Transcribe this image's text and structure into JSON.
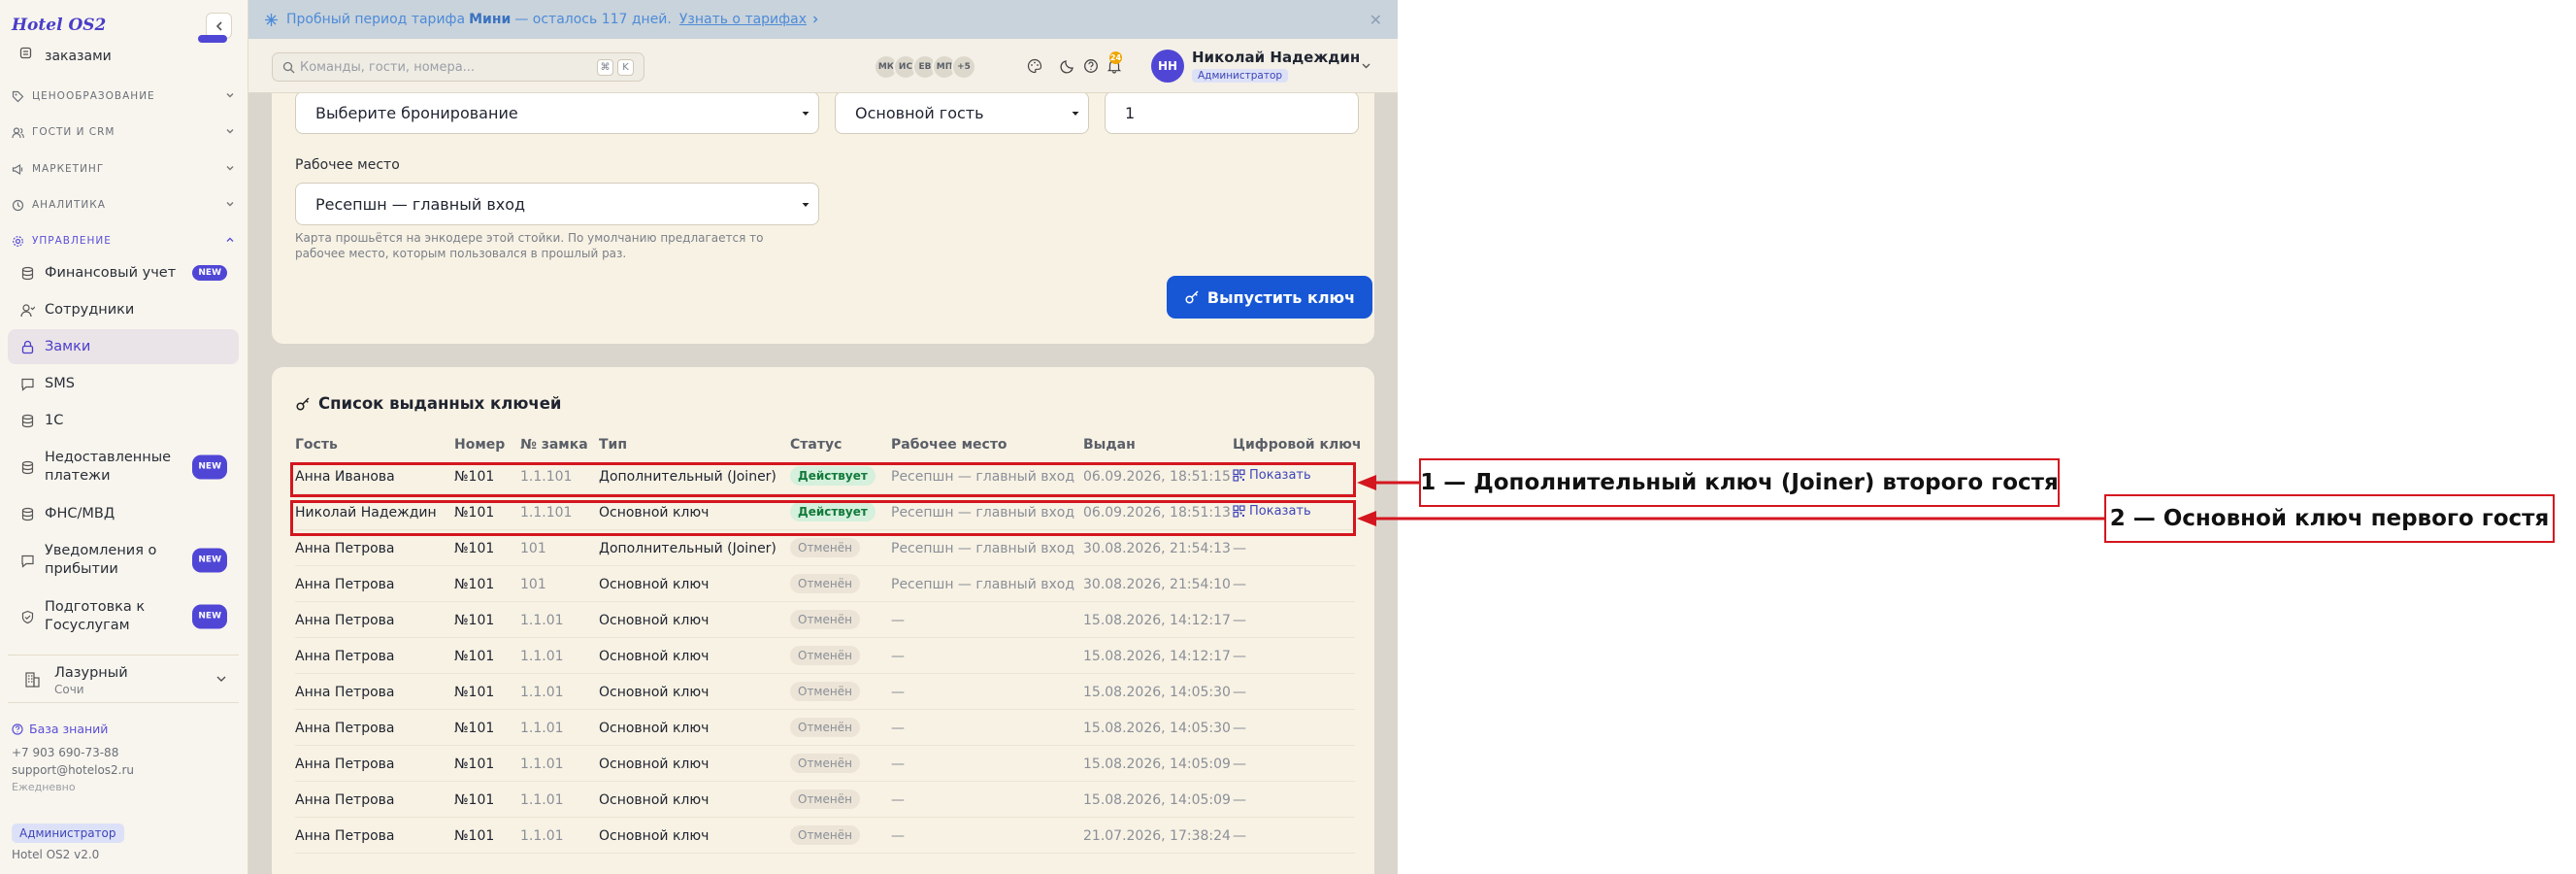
{
  "app": {
    "logo": "Hotel OS2",
    "version": "Hotel OS2 v2.0"
  },
  "banner": {
    "prefix": "Пробный период тарифа",
    "plan": "Мини",
    "suffix": "— осталось 117 дней.",
    "link": "Узнать о тарифах"
  },
  "search": {
    "placeholder": "Команды, гости, номера...",
    "kbd1": "⌘",
    "kbd2": "K"
  },
  "header": {
    "avatars": [
      "МК",
      "ИС",
      "ЕВ",
      "МП",
      "+5"
    ],
    "notif_count": "24",
    "user": {
      "initials": "НН",
      "name": "Николай Надеждин",
      "role": "Администратор"
    }
  },
  "sidebar": {
    "top_item": "заказами",
    "sections": [
      {
        "label": "ЦЕНООБРАЗОВАНИЕ"
      },
      {
        "label": "ГОСТИ И CRM"
      },
      {
        "label": "МАРКЕТИНГ"
      },
      {
        "label": "АНАЛИТИКА"
      },
      {
        "label": "УПРАВЛЕНИЕ"
      }
    ],
    "items": [
      {
        "label": "Финансовый учет",
        "badge": "NEW"
      },
      {
        "label": "Сотрудники"
      },
      {
        "label": "Замки"
      },
      {
        "label": "SMS"
      },
      {
        "label": "1С"
      },
      {
        "label": "Недоставленные платежи",
        "badge": "NEW"
      },
      {
        "label": "ФНС/МВД"
      },
      {
        "label": "Уведомления о прибытии",
        "badge": "NEW"
      },
      {
        "label": "Подготовка к Госуслугам",
        "badge": "NEW"
      }
    ],
    "hotel": {
      "name": "Лазурный",
      "city": "Сочи"
    },
    "knowledge": "База знаний",
    "phone": "+7 903 690-73-88",
    "email": "support@hotelos2.ru",
    "hours": "Ежедневно",
    "role": "Администратор"
  },
  "form": {
    "booking": "Выберите бронирование",
    "guest": "Основной гость",
    "count": "1",
    "workplace_label": "Рабочее место",
    "workplace": "Ресепшн — главный вход",
    "hint": "Карта прошьётся на энкодере этой стойки. По умолчанию предлагается то рабочее место, которым пользовался в прошлый раз.",
    "issue_button": "Выпустить ключ"
  },
  "keys": {
    "title": "Список выданных ключей",
    "columns": [
      "Гость",
      "Номер",
      "№ замка",
      "Тип",
      "Статус",
      "Рабочее место",
      "Выдан",
      "Цифровой ключ"
    ],
    "show_label": "Показать",
    "rows": [
      {
        "guest": "Анна Иванова",
        "room": "№101",
        "lock": "1.1.101",
        "type": "Дополнительный (Joiner)",
        "status": "Действует",
        "active": true,
        "place": "Ресепшн — главный вход",
        "issued": "06.09.2026, 18:51:15",
        "digital": "show"
      },
      {
        "guest": "Николай Надеждин",
        "room": "№101",
        "lock": "1.1.101",
        "type": "Основной ключ",
        "status": "Действует",
        "active": true,
        "place": "Ресепшн — главный вход",
        "issued": "06.09.2026, 18:51:13",
        "digital": "show"
      },
      {
        "guest": "Анна Петрова",
        "room": "№101",
        "lock": "101",
        "type": "Дополнительный (Joiner)",
        "status": "Отменён",
        "active": false,
        "place": "Ресепшн — главный вход",
        "issued": "30.08.2026, 21:54:13",
        "digital": "—"
      },
      {
        "guest": "Анна Петрова",
        "room": "№101",
        "lock": "101",
        "type": "Основной ключ",
        "status": "Отменён",
        "active": false,
        "place": "Ресепшн — главный вход",
        "issued": "30.08.2026, 21:54:10",
        "digital": "—"
      },
      {
        "guest": "Анна Петрова",
        "room": "№101",
        "lock": "1.1.01",
        "type": "Основной ключ",
        "status": "Отменён",
        "active": false,
        "place": "—",
        "issued": "15.08.2026, 14:12:17",
        "digital": "—"
      },
      {
        "guest": "Анна Петрова",
        "room": "№101",
        "lock": "1.1.01",
        "type": "Основной ключ",
        "status": "Отменён",
        "active": false,
        "place": "—",
        "issued": "15.08.2026, 14:12:17",
        "digital": "—"
      },
      {
        "guest": "Анна Петрова",
        "room": "№101",
        "lock": "1.1.01",
        "type": "Основной ключ",
        "status": "Отменён",
        "active": false,
        "place": "—",
        "issued": "15.08.2026, 14:05:30",
        "digital": "—"
      },
      {
        "guest": "Анна Петрова",
        "room": "№101",
        "lock": "1.1.01",
        "type": "Основной ключ",
        "status": "Отменён",
        "active": false,
        "place": "—",
        "issued": "15.08.2026, 14:05:30",
        "digital": "—"
      },
      {
        "guest": "Анна Петрова",
        "room": "№101",
        "lock": "1.1.01",
        "type": "Основной ключ",
        "status": "Отменён",
        "active": false,
        "place": "—",
        "issued": "15.08.2026, 14:05:09",
        "digital": "—"
      },
      {
        "guest": "Анна Петрова",
        "room": "№101",
        "lock": "1.1.01",
        "type": "Основной ключ",
        "status": "Отменён",
        "active": false,
        "place": "—",
        "issued": "15.08.2026, 14:05:09",
        "digital": "—"
      },
      {
        "guest": "Анна Петрова",
        "room": "№101",
        "lock": "1.1.01",
        "type": "Основной ключ",
        "status": "Отменён",
        "active": false,
        "place": "—",
        "issued": "21.07.2026, 17:38:24",
        "digital": "—"
      }
    ]
  },
  "annotations": {
    "callout1": "1 — Дополнительный ключ (Joiner) второго гостя",
    "callout2": "2 — Основной ключ первого гостя",
    "color": "#d4161f"
  },
  "colors": {
    "accent": "#5046d6",
    "primary_button": "#1757d6",
    "active_badge": "#137a3a"
  }
}
